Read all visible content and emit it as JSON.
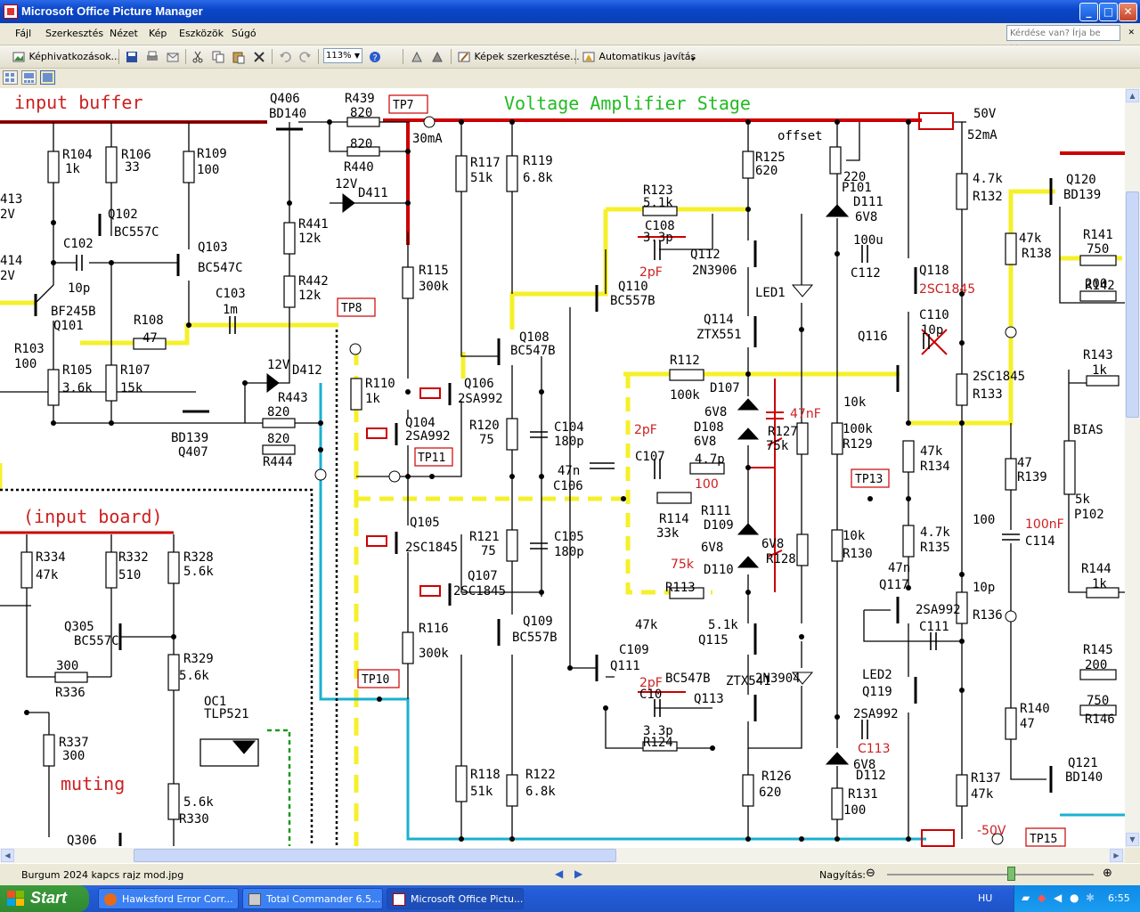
{
  "window": {
    "title": "Microsoft Office Picture Manager",
    "minimize": "_",
    "maximize": "□",
    "close": "✕"
  },
  "menu": {
    "items": [
      "Fájl",
      "Szerkesztés",
      "Nézet",
      "Kép",
      "Eszközök",
      "Súgó"
    ],
    "help_placeholder": "Kérdése van? Írja be ide."
  },
  "toolbar": {
    "shortcuts": "Képhivatkozások...",
    "zoom": "113%",
    "edit_pictures": "Képek szerkesztése...",
    "auto_correct": "Automatikus javítás"
  },
  "icons": [
    "picture-shortcuts-icon",
    "save-icon",
    "print-icon",
    "email-icon",
    "cut-icon",
    "copy-icon",
    "paste-icon",
    "delete-icon",
    "undo-icon",
    "redo-icon",
    "help-icon",
    "rotate-left-icon",
    "rotate-right-icon",
    "edit-pictures-icon",
    "auto-correct-icon"
  ],
  "schematic": {
    "headings": {
      "input_buffer": "input buffer",
      "vas": "Voltage Amplifier Stage",
      "input_board": "(input board)",
      "muting": "muting"
    },
    "testpoints": [
      "TP7",
      "TP8",
      "TP11",
      "TP10",
      "TP13",
      "TP15"
    ],
    "labels": [
      "Q406",
      "BD140",
      "R439",
      "820",
      "820",
      "R440",
      "30mA",
      "12V",
      "D411",
      "R441",
      "12k",
      "R442",
      "12k",
      "R104",
      "1k",
      "R106",
      "33",
      "R109",
      "100",
      "Q102",
      "BC557C",
      "C102",
      "10p",
      "Q103",
      "BC547C",
      "413",
      "2V",
      "414",
      "2V",
      "BF245B",
      "Q101",
      "R108",
      "47",
      "C103",
      "1m",
      "R103",
      "100",
      "R105",
      "3.6k",
      "R107",
      "15k",
      "12V",
      "D412",
      "R443",
      "820",
      "820",
      "R444",
      "BD139",
      "Q407",
      "R115",
      "300k",
      "R110",
      "1k",
      "R117",
      "51k",
      "R119",
      "6.8k",
      "Q104",
      "2SA992",
      "Q106",
      "2SA992",
      "Q108",
      "BC547B",
      "R120",
      "75",
      "C104",
      "180p",
      "47n",
      "C106",
      "R121",
      "75",
      "C105",
      "180p",
      "Q105",
      "2SC1845",
      "Q107",
      "2SC1845",
      "Q109",
      "BC557B",
      "R116",
      "300k",
      "R118",
      "51k",
      "R122",
      "6.8k",
      "R123",
      "5.1k",
      "C108",
      "3.3p",
      "2pF",
      "Q110",
      "BC557B",
      "Q112",
      "2N3906",
      "LED1",
      "Q114",
      "ZTX551",
      "R125",
      "620",
      "offset",
      "220",
      "P101",
      "D111",
      "6V8",
      "100u",
      "C112",
      "Q118",
      "2SC1845",
      "C110",
      "10p",
      "Q116",
      "R112",
      "100k",
      "D107",
      "6V8",
      "D108",
      "6V8",
      "47nF",
      "R127",
      "75k",
      "2pF",
      "C107",
      "4.7p",
      "100",
      "R114",
      "33k",
      "R111",
      "D109",
      "6V8",
      "D110",
      "6V8",
      "R128",
      "75k",
      "R113",
      "100k",
      "R129",
      "10k",
      "R130",
      "10k",
      "2SC1845",
      "R133",
      "47k",
      "R134",
      "4.7k",
      "R135",
      "4.7k",
      "R132",
      "47k",
      "R138",
      "47",
      "R139",
      "100",
      "100nF",
      "C114",
      "47n",
      "Q117",
      "2SA992",
      "C111",
      "10p",
      "R136",
      "47k",
      "C109",
      "Q111",
      "BC547B",
      "2pF",
      "C10",
      "3.3p",
      "R124",
      "5.1k",
      "Q115",
      "ZTX541",
      "Q113",
      "2N3904",
      "LED2",
      "Q119",
      "2SA992",
      "C113",
      "6V8",
      "D112",
      "R126",
      "620",
      "R131",
      "100",
      "R140",
      "47",
      "R137",
      "47k",
      "Q121",
      "BD140",
      "-50V",
      "50V",
      "52mA",
      "Q120",
      "BD139",
      "R141",
      "750",
      "R142",
      "200",
      "R143",
      "1k",
      "BIAS",
      "5k",
      "P102",
      "R144",
      "1k",
      "R145",
      "200",
      "750",
      "R146",
      "R334",
      "47k",
      "R332",
      "510",
      "R328",
      "5.6k",
      "Q305",
      "BC557C",
      "R329",
      "5.6k",
      "300",
      "R336",
      "OC1",
      "TLP521",
      "R337",
      "300",
      "5.6k",
      "R330",
      "Q306"
    ]
  },
  "status": {
    "filename": "Burgum 2024 kapcs rajz mod.jpg",
    "zoom_label": "Nagyítás:",
    "zoom_level": 0.6
  },
  "taskbar": {
    "start": "Start",
    "tasks": [
      "Hawksford Error Corr...",
      "Total Commander 6.5...",
      "Microsoft Office Pictu..."
    ],
    "lang": "HU",
    "clock": "6:55"
  }
}
